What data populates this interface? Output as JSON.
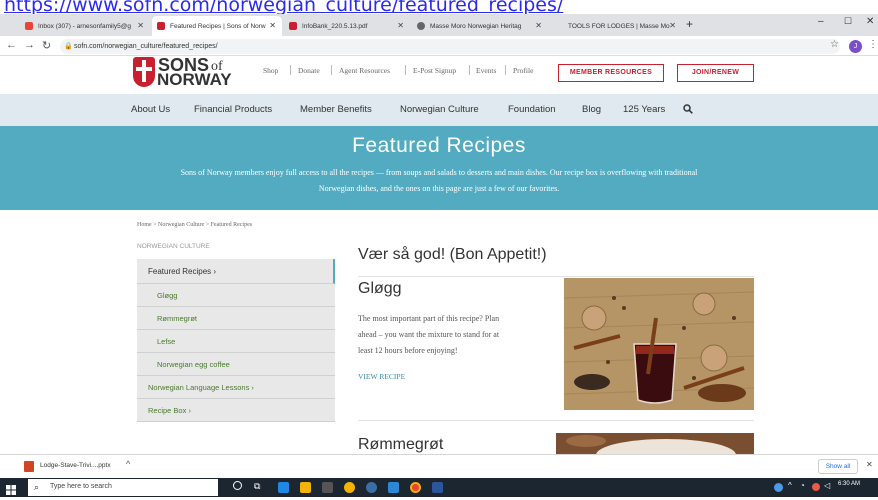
{
  "caption_url": "https://www.sofn.com/norwegian_culture/featured_recipes/",
  "browser": {
    "tabs": [
      {
        "label": "Inbox (307) - arnesonfamily5@g"
      },
      {
        "label": "Featured Recipes | Sons of Norw"
      },
      {
        "label": "InfoBank_220.5.13.pdf"
      },
      {
        "label": "Masse Moro Norwegian Heritag"
      },
      {
        "label": "TOOLS FOR LODGES | Masse Mo"
      }
    ],
    "url": "sofn.com/norwegian_culture/featured_recipes/",
    "profile_initial": "J"
  },
  "site": {
    "logo_sons": "SONS",
    "logo_of": "of",
    "logo_norway": "NORWAY",
    "utility_links": [
      "Shop",
      "Donate",
      "Agent Resources",
      "E-Post Signup",
      "Events",
      "Profile"
    ],
    "member_resources": "MEMBER RESOURCES",
    "join_renew": "JOIN/RENEW",
    "nav": [
      "About Us",
      "Financial Products",
      "Member Benefits",
      "Norwegian Culture",
      "Foundation",
      "Blog",
      "125 Years"
    ]
  },
  "hero": {
    "title": "Featured Recipes",
    "text_line1": "Sons of Norway members enjoy full access to all the recipes — from soups and salads to desserts and main dishes. Our recipe box is overflowing with traditional",
    "text_line2": "Norwegian dishes, and the ones on this page are just a few of our favorites."
  },
  "content": {
    "breadcrumb": "Home > Norwegian Culture > Featured Recipes",
    "sidebar_title": "NORWEGIAN CULTURE",
    "sidebar_active": "Featured Recipes",
    "sidebar_sub": [
      "Gløgg",
      "Rømmegrøt",
      "Lefse",
      "Norwegian egg coffee"
    ],
    "sidebar_more": [
      "Norwegian Language Lessons",
      "Recipe Box"
    ],
    "section_title": "Vær så god! (Bon Appetit!)",
    "recipe": {
      "title": "Gløgg",
      "desc_lines": [
        "The most important part of this recipe? Plan",
        "ahead – you want the mixture to stand for at",
        "least 12 hours before enjoying!"
      ],
      "link": "VIEW RECIPE"
    },
    "recipe2_title": "Rømmegrøt"
  },
  "downloads": {
    "file": "Lodge-Stave-Trivi....pptx",
    "show_all": "Show all"
  },
  "taskbar": {
    "search_placeholder": "Type here to search",
    "time": "6:30 AM"
  },
  "colors": {
    "accent_teal": "#52abc1",
    "brand_red": "#c8202f",
    "nav_bg": "#dfe9ef"
  }
}
